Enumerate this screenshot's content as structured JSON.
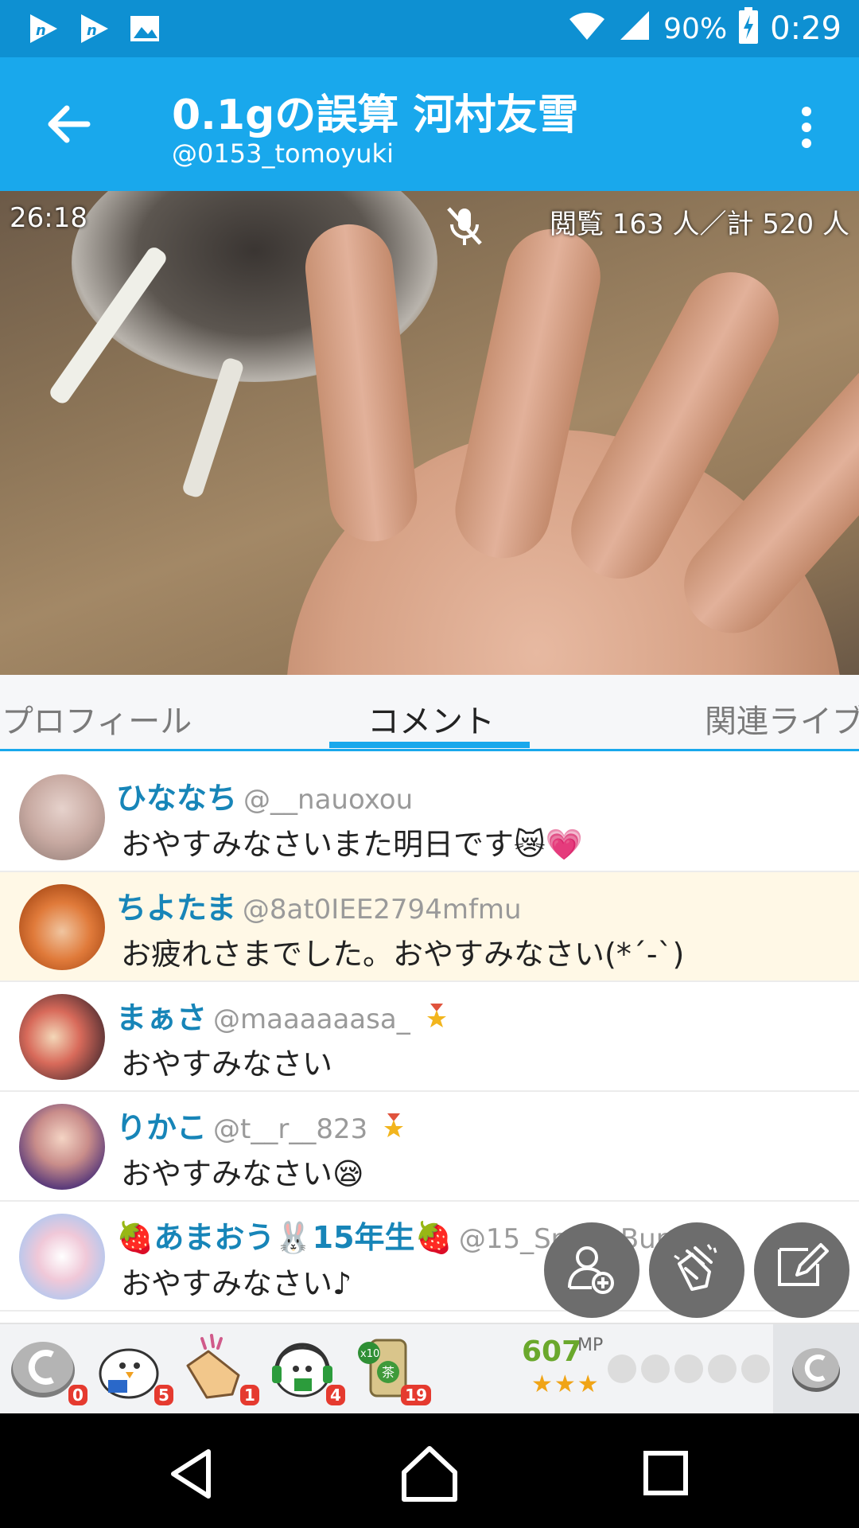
{
  "status_bar": {
    "battery": "90%",
    "time": "0:29",
    "icons": [
      "n-app-icon",
      "n-app-icon",
      "image-icon",
      "wifi-icon",
      "signal-icon",
      "battery-charging-icon"
    ]
  },
  "header": {
    "title": "0.1gの誤算 河村友雪",
    "subtitle": "@0153_tomoyuki"
  },
  "video": {
    "elapsed": "26:18",
    "viewers": "閲覧 163 人／計 520 人"
  },
  "tabs": [
    {
      "label": "プロフィール",
      "active": false
    },
    {
      "label": "コメント",
      "active": true
    },
    {
      "label": "関連ライブ",
      "active": false
    }
  ],
  "comments": [
    {
      "name": "ひななち",
      "handle": "@__nauoxou",
      "text": "おやすみなさいまた明日です😿💗",
      "highlight": false
    },
    {
      "name": "ちよたま",
      "handle": "@8at0IEE2794mfmu",
      "text": "お疲れさまでした。おやすみなさい(*´-`)",
      "highlight": true
    },
    {
      "name": "まぁさ",
      "handle": "@maaaaaasa_",
      "text": "おやすみなさい",
      "highlight": false
    },
    {
      "name": "りかこ",
      "handle": "@t__r__823",
      "text": "おやすみなさい😪",
      "highlight": false
    },
    {
      "name": "🍓あまおう🐰15年生🍓",
      "handle": "@15_Snow_Bunny",
      "text": "おやすみなさい♪",
      "highlight": false
    }
  ],
  "gifts": [
    {
      "name": "coin-gift-icon",
      "count": "0"
    },
    {
      "name": "bird-gift-icon",
      "count": "5"
    },
    {
      "name": "clap-gift-icon",
      "count": "1"
    },
    {
      "name": "headphone-bird-gift-icon",
      "count": "4"
    },
    {
      "name": "tea-can-gift-icon",
      "count": "19"
    }
  ],
  "mp": {
    "value": "607",
    "unit": "MP",
    "stars": "★★★"
  },
  "colors": {
    "status_bar": "#0e90d2",
    "app_bar": "#19a8ec",
    "username": "#1785b8",
    "highlight": "#fff8e6",
    "badge": "#e53a2f"
  }
}
